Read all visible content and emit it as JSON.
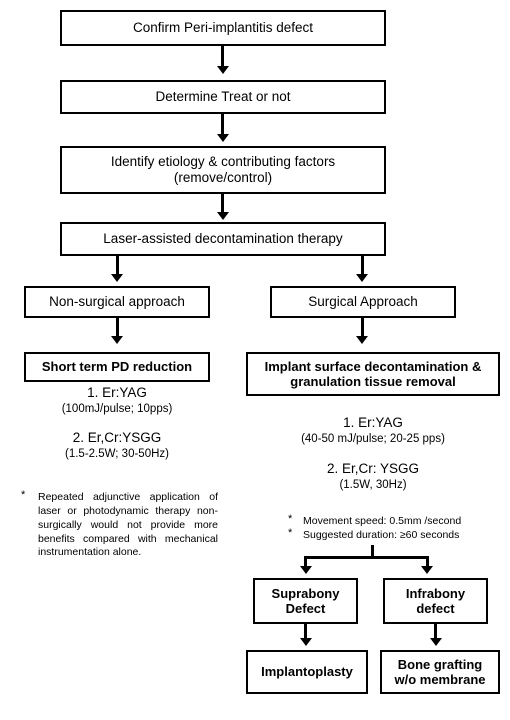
{
  "diagram": {
    "title": "Peri-implantitis laser-assisted treatment decision flowchart",
    "nodes": {
      "confirm_defect": "Confirm Peri-implantitis defect",
      "determine_treat": "Determine Treat or not",
      "identify_etiology_line1": "Identify etiology & contributing factors",
      "identify_etiology_line2": "(remove/control)",
      "laser_therapy": "Laser-assisted decontamination therapy",
      "non_surgical": "Non-surgical approach",
      "surgical": "Surgical Approach",
      "short_term_pd": "Short term PD reduction",
      "implant_surface_line1": "Implant surface decontamination &",
      "implant_surface_line2": "granulation tissue removal",
      "suprabony_line1": "Suprabony",
      "suprabony_line2": "Defect",
      "infrabony_line1": "Infrabony",
      "infrabony_line2": "defect",
      "implantoplasty": "Implantoplasty",
      "bone_grafting_line1": "Bone grafting",
      "bone_grafting_line2": "w/o membrane"
    },
    "non_surgical_params": {
      "item1_title": "1. Er:YAG",
      "item1_values": "(100mJ/pulse; 10pps)",
      "item2_title": "2. Er,Cr:YSGG",
      "item2_values": "(1.5-2.5W; 30-50Hz)",
      "note_marker": "*",
      "note_text": "Repeated adjunctive application of laser or photodynamic therapy non-surgically would not provide more benefits compared with mechanical instrumentation alone."
    },
    "surgical_params": {
      "item1_title": "1. Er:YAG",
      "item1_values": "(40-50 mJ/pulse; 20-25 pps)",
      "item2_title": "2.  Er,Cr: YSGG",
      "item2_values": "(1.5W, 30Hz)",
      "note_marker": "*",
      "note1": "Movement speed: 0.5mm /second",
      "note2": "Suggested duration: ≥60 seconds"
    },
    "colors": {
      "stroke": "#000000",
      "background": "#ffffff",
      "text": "#000000"
    }
  }
}
